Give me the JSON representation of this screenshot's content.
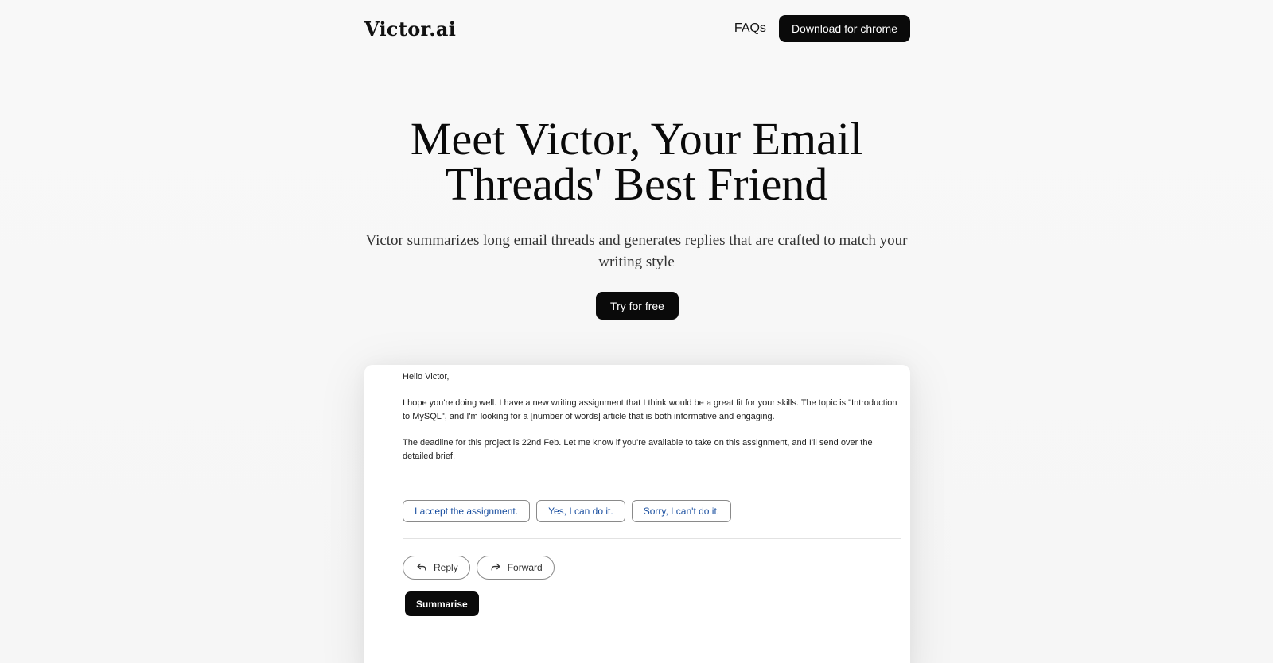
{
  "nav": {
    "logo": "Victor.ai",
    "faqs_label": "FAQs",
    "download_label": "Download for chrome"
  },
  "hero": {
    "title_line1": "Meet Victor, Your Email",
    "title_line2": "Threads' Best Friend",
    "subtitle": "Victor summarizes long email threads and generates replies that are crafted to match your writing style",
    "cta_label": "Try for free"
  },
  "preview": {
    "email": {
      "greeting": "Hello Victor,",
      "paragraph1": "I hope you're doing well. I have a new writing assignment that I think would be a great fit for your skills. The topic is \"Introduction to MySQL\", and I'm looking for a [number of words] article that is both informative and engaging.",
      "paragraph2": "The deadline for this project is 22nd Feb. Let me know if you're available to take on this assignment, and I'll send over the detailed brief."
    },
    "suggestions": [
      "I accept the assignment.",
      "Yes, I can do it.",
      "Sorry, I can't do it."
    ],
    "actions": {
      "reply_label": "Reply",
      "forward_label": "Forward",
      "summarise_label": "Summarise"
    }
  },
  "colors": {
    "background": "#f8f8f8",
    "button_dark": "#0a0a0a",
    "suggestion_text": "#1a4fa0"
  },
  "icons": {
    "reply": "reply-arrow-icon",
    "forward": "forward-arrow-icon"
  }
}
